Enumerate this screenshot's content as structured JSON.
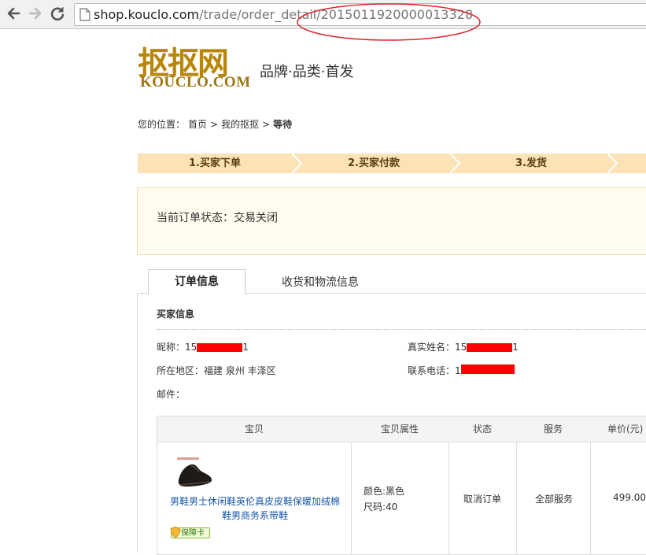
{
  "browser": {
    "url_host": "shop.kouclo.com",
    "url_path": "/trade/order_detail/2015011920000013328"
  },
  "logo": {
    "cn": "抠抠网",
    "en": "KOUCLO.COM"
  },
  "tagline": "品牌·品类·首发",
  "breadcrumb": {
    "prefix": "您的位置：",
    "home": "首页",
    "sep1": ">",
    "mine": "我的抠抠",
    "sep2": ">",
    "current": "等待"
  },
  "steps": [
    "1.买家下单",
    "2.买家付款",
    "3.发货"
  ],
  "status": {
    "label": "当前订单状态：",
    "value": "交易关闭"
  },
  "tabs": {
    "active": "订单信息",
    "other": "收货和物流信息"
  },
  "buyer": {
    "title": "买家信息",
    "nickname_label": "昵称：",
    "nickname_prefix": "15",
    "nickname_suffix": "1",
    "realname_label": "真实姓名：",
    "realname_prefix": "15",
    "realname_suffix": "1",
    "region_label": "所在地区：",
    "region_value": "福建 泉州 丰泽区",
    "phone_label": "联系电话：",
    "phone_prefix": "1",
    "email_label": "邮件："
  },
  "table": {
    "headers": [
      "宝贝",
      "宝贝属性",
      "状态",
      "服务",
      "单价(元)"
    ],
    "row": {
      "title": "男鞋男士休闲鞋英伦真皮皮鞋保暖加绒棉鞋男商务系带鞋",
      "badge": "保障卡",
      "attr_color": "颜色:黑色",
      "attr_size": "尺码:40",
      "status": "取消订单",
      "service": "全部服务",
      "price": "499.00"
    }
  },
  "colors": {
    "steps_bg": "#fbe3b6",
    "status_bg": "#fffbee",
    "annotation": "#d9272e",
    "redaction": "#ff0000",
    "link": "#1a57a8"
  }
}
